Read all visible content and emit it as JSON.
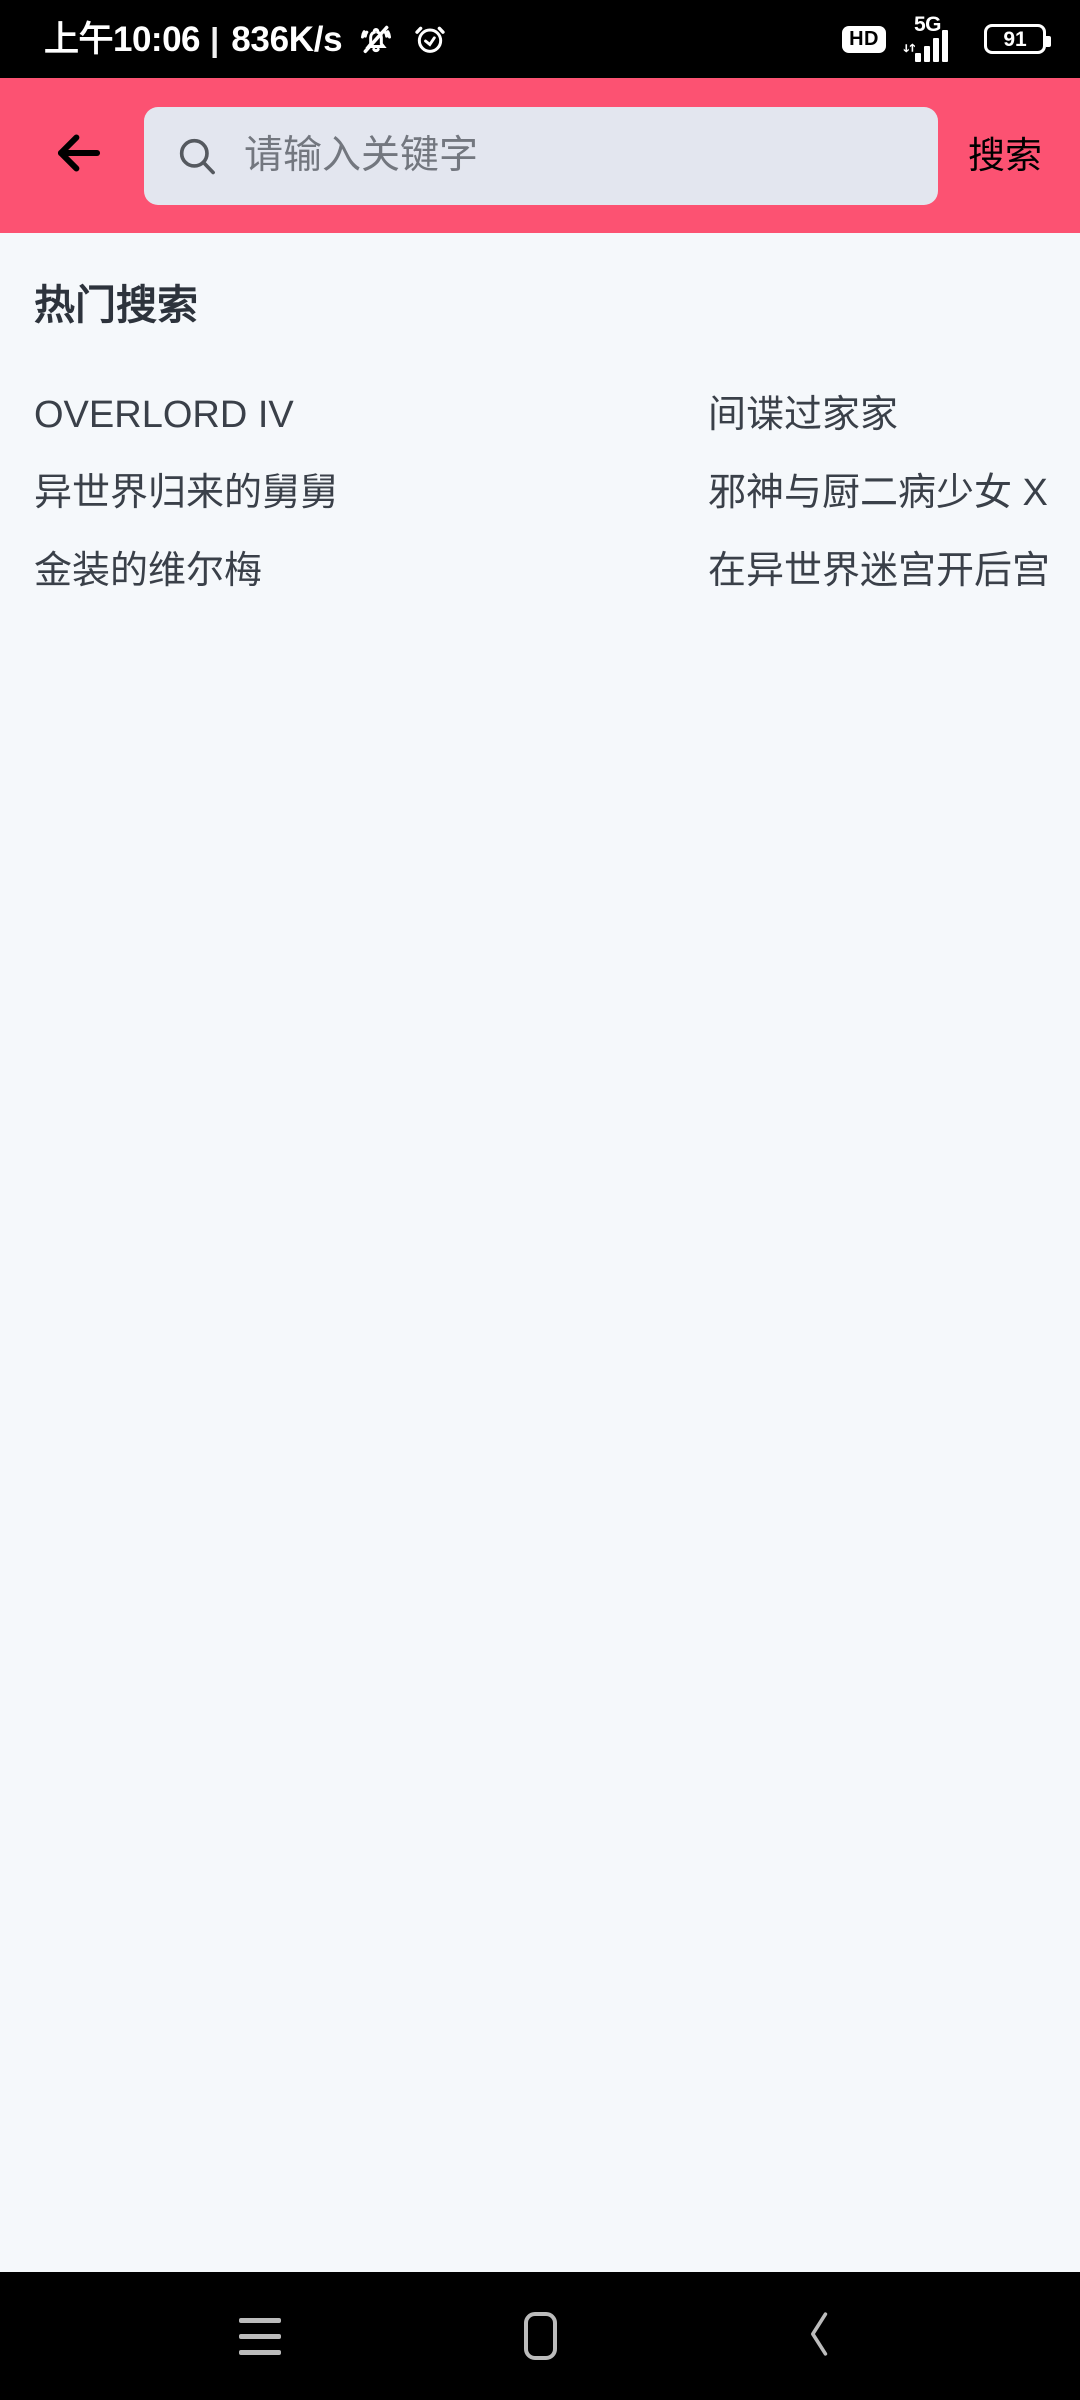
{
  "status_bar": {
    "clock": "上午10:06",
    "separator": "|",
    "network_speed": "836K/s",
    "icons": [
      "bell-muted-icon",
      "alarm-clock-icon"
    ],
    "hd_badge": "HD",
    "signal_label": "5G",
    "battery_level": "91",
    "background": "#000000",
    "foreground": "#ffffff"
  },
  "header": {
    "background": "#fc5272",
    "back_icon": "back-arrow-icon",
    "search": {
      "icon": "search-icon",
      "value": "",
      "placeholder": "请输入关键字",
      "background": "#e3e6ef"
    },
    "action_label": "搜索"
  },
  "main": {
    "background": "#f5f8fb",
    "section_title": "热门搜索",
    "hot_searches": [
      {
        "label": "OVERLORD IV"
      },
      {
        "label": "间谍过家家"
      },
      {
        "label": "异世界归来的舅舅"
      },
      {
        "label": "邪神与厨二病少女 X"
      },
      {
        "label": "金装的维尔梅"
      },
      {
        "label": "在异世界迷宫开后宫"
      }
    ]
  },
  "nav_bar": {
    "background": "#000000",
    "buttons": [
      {
        "name": "recents-icon"
      },
      {
        "name": "home-icon"
      },
      {
        "name": "back-icon"
      }
    ]
  }
}
